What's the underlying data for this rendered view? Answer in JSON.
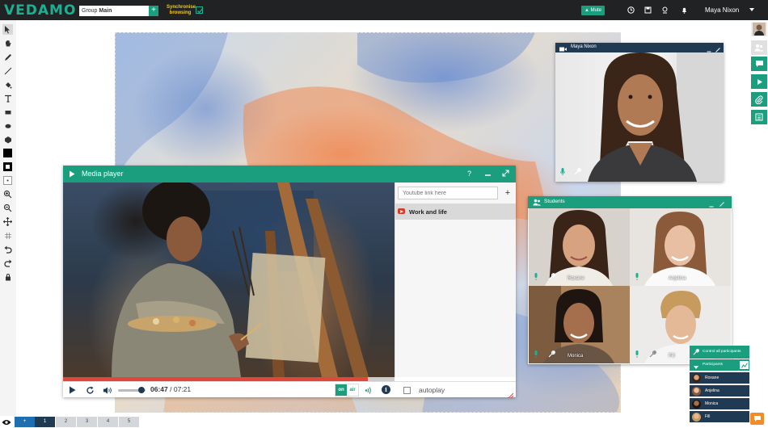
{
  "topbar": {
    "logo": "VEDAMO",
    "group_label": "Group",
    "group_value": "Main",
    "group_add": "+",
    "sync_label": "Synchronise browsing",
    "mute_label": "Mute",
    "user_name": "Maya Nixon"
  },
  "media_player": {
    "title": "Media player",
    "help": "?",
    "youtube_placeholder": "Youtube link here",
    "add": "+",
    "playlist": [
      {
        "label": "Work and life"
      }
    ],
    "progress": 0.92,
    "volume": 0.85,
    "time_current": "06:47",
    "time_separator": " / ",
    "time_total": "07:21",
    "on_label": "on",
    "air_label": "air",
    "info": "i",
    "autoplay_label": "autoplay"
  },
  "tutor_cam": {
    "name": "Maya Nixon"
  },
  "students": {
    "title": "Students",
    "tiles": [
      {
        "name": "Roxane"
      },
      {
        "name": "Anjelina"
      },
      {
        "name": "Monica"
      },
      {
        "name": "Fill"
      }
    ]
  },
  "participants_panel": {
    "control_label": "Control all participants",
    "header_label": "Participants",
    "rows": [
      {
        "name": "Roxane"
      },
      {
        "name": "Anjelina"
      },
      {
        "name": "Monica"
      },
      {
        "name": "Fill"
      }
    ]
  },
  "bottombar": {
    "pages": [
      "+",
      "1",
      "2",
      "3",
      "4",
      "5"
    ]
  },
  "colors": {
    "brand_green": "#1b9e7e",
    "dark_navy": "#1f3a52",
    "topbar": "#202224",
    "progress_red": "#e0473b",
    "sync_yellow": "#f2c81c",
    "chat_orange": "#f28c28"
  },
  "icons": {
    "left_toolbar": [
      "cursor-icon",
      "hand-icon",
      "pen-icon",
      "line-icon",
      "fill-bucket-icon",
      "text-icon",
      "rectangle-icon",
      "ellipse-icon",
      "shapes-icon",
      "color-swatch-icon",
      "stroke-swatch-icon",
      "size-icon",
      "zoom-in-icon",
      "zoom-out-icon",
      "move-icon",
      "grid-icon",
      "undo-icon",
      "redo-icon",
      "lock-icon"
    ],
    "right_toolbar": [
      "user-avatar-icon",
      "users-icon",
      "chat-icon",
      "play-icon",
      "attachment-icon",
      "list-icon"
    ]
  }
}
